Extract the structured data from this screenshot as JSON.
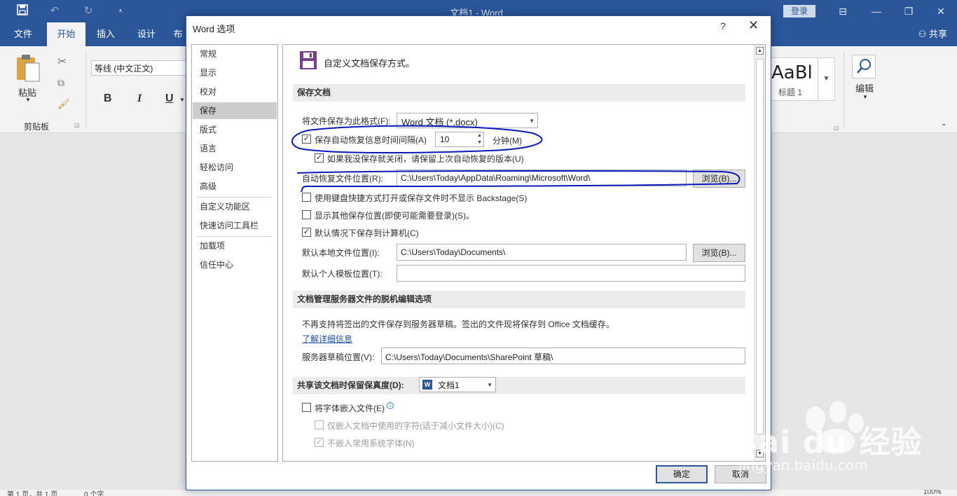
{
  "window": {
    "title": "文档1 - Word",
    "login_label": "登录",
    "share_label": "共享"
  },
  "tabs": [
    "文件",
    "开始",
    "插入",
    "设计",
    "布"
  ],
  "ribbon": {
    "paste_label": "粘贴",
    "clipboard_group": "剪贴板",
    "font_name": "等线 (中文正文)",
    "bold": "B",
    "italic": "I",
    "underline": "U",
    "style_sample": "AaBl",
    "style_name": "标题 1",
    "edit_label": "编辑"
  },
  "dialog": {
    "title": "Word 选项",
    "help": "?",
    "close": "✕",
    "nav": [
      "常规",
      "显示",
      "校对",
      "保存",
      "版式",
      "语言",
      "轻松访问",
      "高级",
      "自定义功能区",
      "快速访问工具栏",
      "加载项",
      "信任中心"
    ],
    "selected_nav": "保存",
    "header": "自定义文档保存方式。",
    "section_save": "保存文档",
    "format_label": "将文件保存为此格式(F):",
    "format_value": "Word 文档 (*.docx)",
    "autorecover_label": "保存自动恢复信息时间间隔(A)",
    "autorecover_checked": true,
    "autorecover_minutes": "10",
    "minutes_label": "分钟(M)",
    "keep_last_label": "如果我没保存就关闭，请保留上次自动恢复的版本(U)",
    "keep_last_checked": true,
    "autorecover_loc_label": "自动恢复文件位置(R):",
    "autorecover_loc_value": "C:\\Users\\Today\\AppData\\Roaming\\Microsoft\\Word\\",
    "browse_label": "浏览(B)...",
    "no_backstage_label": "使用键盘快捷方式打开或保存文件时不显示 Backstage(S)",
    "no_backstage_checked": false,
    "show_other_label": "显示其他保存位置(即使可能需要登录)(S)。",
    "show_other_checked": false,
    "save_local_label": "默认情况下保存到计算机(C)",
    "save_local_checked": true,
    "default_local_label": "默认本地文件位置(I):",
    "default_local_value": "C:\\Users\\Today\\Documents\\",
    "default_template_label": "默认个人模板位置(T):",
    "default_template_value": "",
    "section_offline": "文档管理服务器文件的脱机编辑选项",
    "offline_note": "不再支持将签出的文件保存到服务器草稿。签出的文件现将保存到 Office 文档缓存。",
    "learn_more": "了解详细信息",
    "server_drafts_label": "服务器草稿位置(V):",
    "server_drafts_value": "C:\\Users\\Today\\Documents\\SharePoint 草稿\\",
    "section_fidelity": "共享该文档时保留保真度(D):",
    "fidelity_doc": "文档1",
    "embed_fonts_label": "将字体嵌入文件(E)",
    "embed_fonts_checked": false,
    "embed_used_label": "仅嵌入文档中使用的字符(适于减小文件大小)(C)",
    "embed_used_checked": false,
    "no_common_label": "不嵌入常用系统字体(N)",
    "no_common_checked": true,
    "ok_label": "确定",
    "cancel_label": "取消"
  },
  "status": {
    "page": "第 1 页，共 1 页",
    "words": "0 个字",
    "zoom": "100%"
  },
  "watermark": {
    "brand": "Bai du 经验",
    "url": "jingyan.baidu.com"
  },
  "colors": {
    "accent": "#2b579a",
    "annotation": "#0a1ab8"
  }
}
